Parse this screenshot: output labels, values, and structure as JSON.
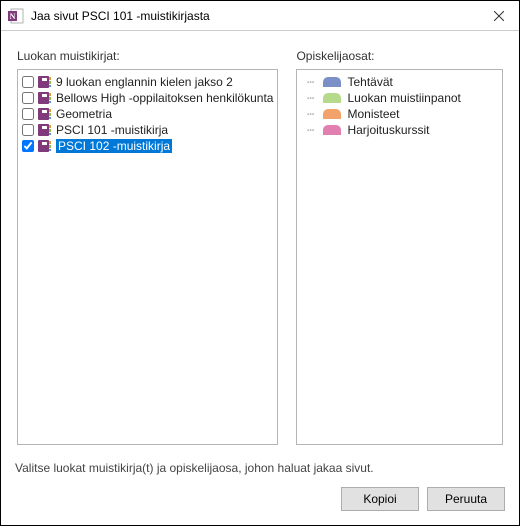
{
  "titlebar": {
    "title": "Jaa sivut PSCI 101 -muistikirjasta"
  },
  "left": {
    "heading": "Luokan muistikirjat:",
    "notebooks": [
      {
        "label": "9 luokan englannin kielen jakso 2",
        "checked": false,
        "selected": false,
        "color": "#80397b"
      },
      {
        "label": "Bellows High -oppilaitoksen henkilökunta",
        "checked": false,
        "selected": false,
        "color": "#80397b"
      },
      {
        "label": "Geometria",
        "checked": false,
        "selected": false,
        "color": "#80397b"
      },
      {
        "label": "PSCI 101 -muistikirja",
        "checked": false,
        "selected": false,
        "color": "#80397b"
      },
      {
        "label": "PSCI 102 -muistikirja",
        "checked": true,
        "selected": true,
        "color": "#80397b"
      }
    ]
  },
  "right": {
    "heading": "Opiskelijaosat:",
    "sections": [
      {
        "label": "Tehtävät",
        "color": "#7d8fc7"
      },
      {
        "label": "Luokan muistiinpanot",
        "color": "#b7d98b"
      },
      {
        "label": "Monisteet",
        "color": "#f2a26b"
      },
      {
        "label": "Harjoituskurssit",
        "color": "#e07fb0"
      }
    ]
  },
  "footer": {
    "text": "Valitse luokat muistikirja(t) ja opiskelijaosa, johon haluat jakaa sivut.",
    "copy": "Kopioi",
    "cancel": "Peruuta"
  }
}
